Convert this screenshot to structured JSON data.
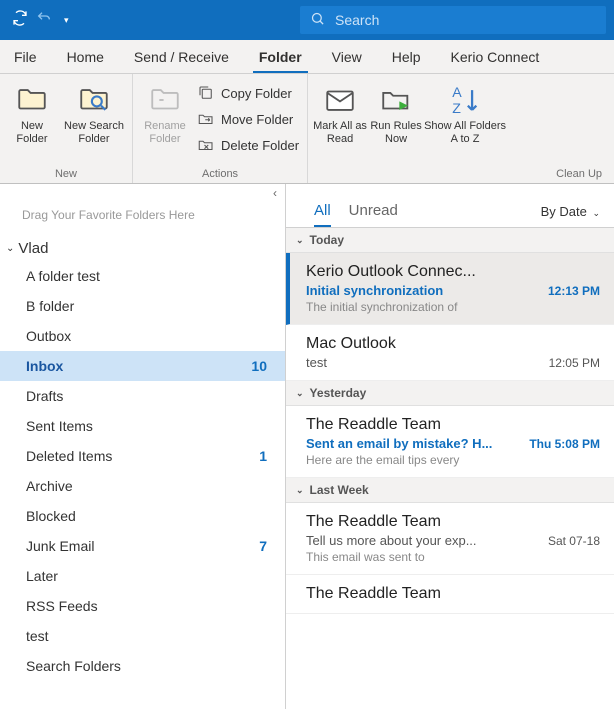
{
  "search": {
    "placeholder": "Search"
  },
  "menuTabs": {
    "file": "File",
    "home": "Home",
    "sendReceive": "Send / Receive",
    "folder": "Folder",
    "view": "View",
    "help": "Help",
    "kerio": "Kerio Connect"
  },
  "ribbon": {
    "groupNew": "New",
    "groupActions": "Actions",
    "groupCleanUp": "Clean Up",
    "newFolder": "New Folder",
    "newSearchFolder": "New Search Folder",
    "renameFolder": "Rename Folder",
    "copyFolder": "Copy Folder",
    "moveFolder": "Move Folder",
    "deleteFolder": "Delete Folder",
    "markAllAsRead": "Mark All as Read",
    "runRulesNow": "Run Rules Now",
    "showAllFoldersAZ": "Show All Folders A to Z"
  },
  "folderPane": {
    "favHint": "Drag Your Favorite Folders Here",
    "account": "Vlad",
    "items": [
      {
        "label": "A folder test",
        "count": ""
      },
      {
        "label": "B folder",
        "count": ""
      },
      {
        "label": "Outbox",
        "count": ""
      },
      {
        "label": "Inbox",
        "count": "10"
      },
      {
        "label": "Drafts",
        "count": ""
      },
      {
        "label": "Sent Items",
        "count": ""
      },
      {
        "label": "Deleted Items",
        "count": "1"
      },
      {
        "label": "Archive",
        "count": ""
      },
      {
        "label": "Blocked",
        "count": ""
      },
      {
        "label": "Junk Email",
        "count": "7"
      },
      {
        "label": "Later",
        "count": ""
      },
      {
        "label": "RSS Feeds",
        "count": ""
      },
      {
        "label": "test",
        "count": ""
      },
      {
        "label": "Search Folders",
        "count": ""
      }
    ]
  },
  "filterBar": {
    "all": "All",
    "unread": "Unread",
    "sort": "By Date"
  },
  "groups": {
    "today": "Today",
    "yesterday": "Yesterday",
    "lastWeek": "Last Week"
  },
  "messages": [
    {
      "from": "Kerio Outlook Connec...",
      "subject": "Initial synchronization",
      "preview": "The initial synchronization of",
      "time": "12:13 PM"
    },
    {
      "from": "Mac Outlook",
      "subject": "test",
      "preview": "",
      "time": "12:05 PM"
    },
    {
      "from": "The Readdle Team",
      "subject": "Sent an email by mistake? H...",
      "preview": "Here are the email tips every",
      "time": "Thu 5:08 PM"
    },
    {
      "from": "The Readdle Team",
      "subject": "Tell us more about your exp...",
      "preview": "This email was sent to",
      "time": "Sat 07-18"
    },
    {
      "from": "The Readdle Team",
      "subject": "",
      "preview": "",
      "time": ""
    }
  ]
}
